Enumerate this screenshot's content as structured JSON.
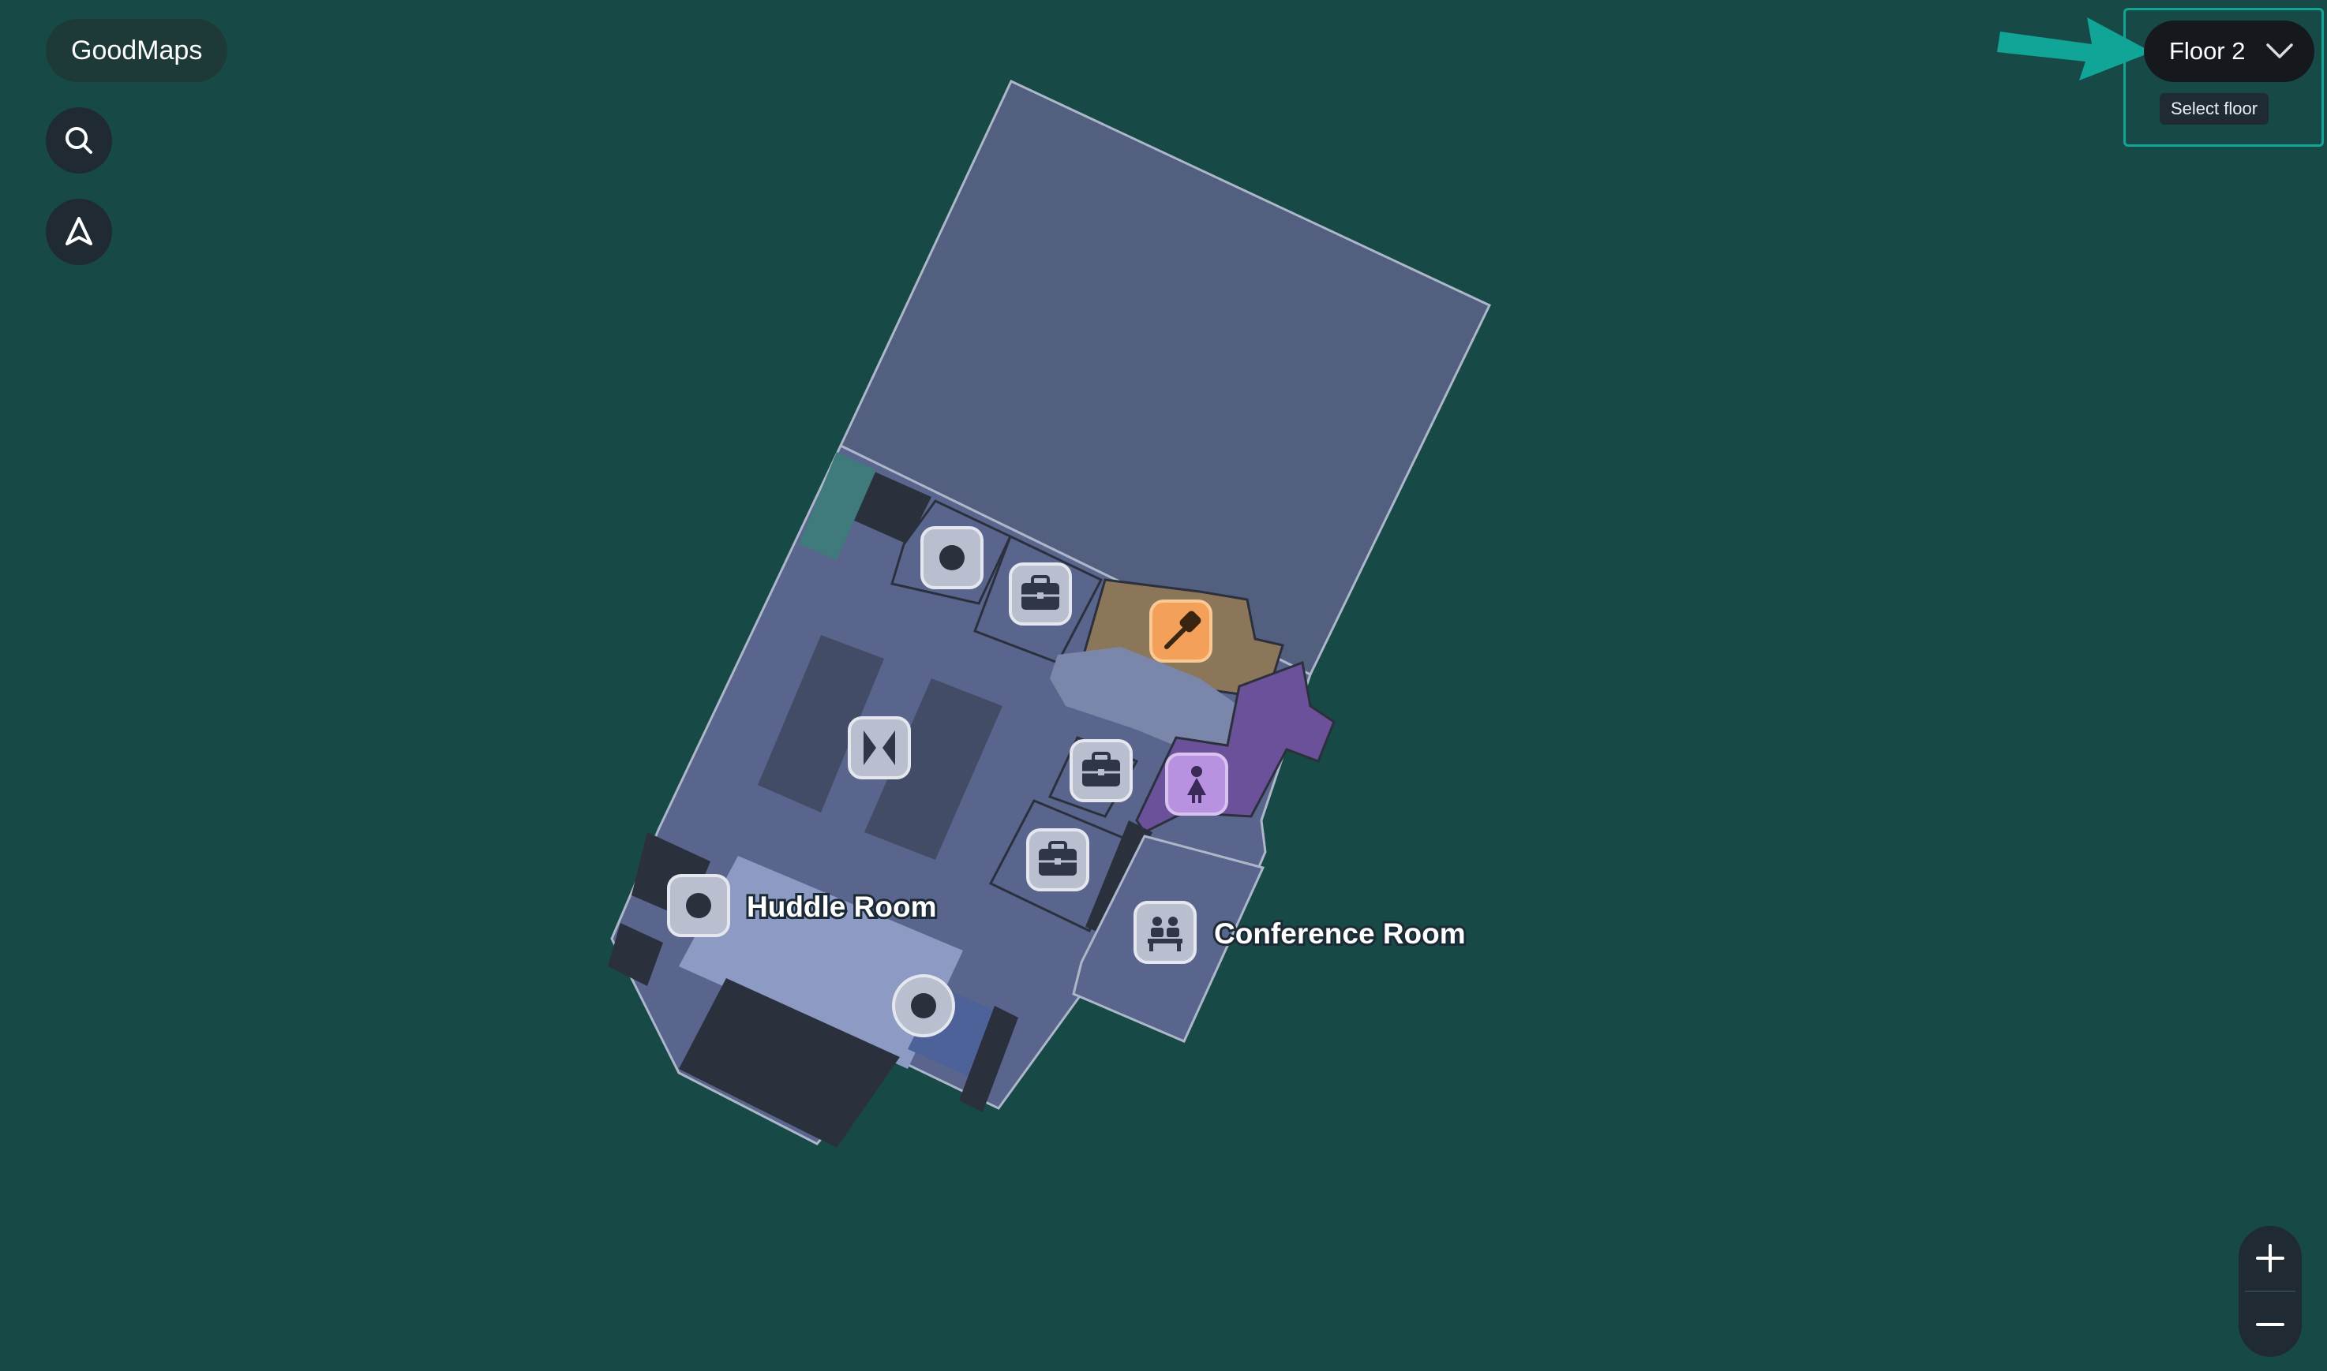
{
  "app": {
    "brand": "GoodMaps"
  },
  "controls": {
    "search_icon": "search-icon",
    "locate_icon": "navigation-arrow-icon",
    "zoom_in_icon": "plus-icon",
    "zoom_out_icon": "minus-icon"
  },
  "floor_selector": {
    "value": "Floor 2",
    "tooltip": "Select floor",
    "icon": "chevron-down-icon"
  },
  "map": {
    "labels": {
      "huddle_room": "Huddle Room",
      "conference_room": "Conference Room"
    },
    "markers": [
      {
        "id": "point-1",
        "icon": "dot-icon"
      },
      {
        "id": "office-1",
        "icon": "briefcase-icon"
      },
      {
        "id": "food",
        "icon": "spatula-icon"
      },
      {
        "id": "elevator",
        "icon": "elevator-icon"
      },
      {
        "id": "office-2",
        "icon": "briefcase-icon"
      },
      {
        "id": "restroom",
        "icon": "woman-icon"
      },
      {
        "id": "office-3",
        "icon": "briefcase-icon"
      },
      {
        "id": "huddle-point",
        "icon": "dot-icon"
      },
      {
        "id": "conference",
        "icon": "people-icon"
      },
      {
        "id": "point-2",
        "icon": "dot-icon"
      }
    ]
  },
  "colors": {
    "background": "#174a47",
    "building": "#525f7f",
    "floor_fill": "#59658c",
    "accent": "#10a596",
    "food": "#f3a15a",
    "restroom": "#b891e0"
  }
}
